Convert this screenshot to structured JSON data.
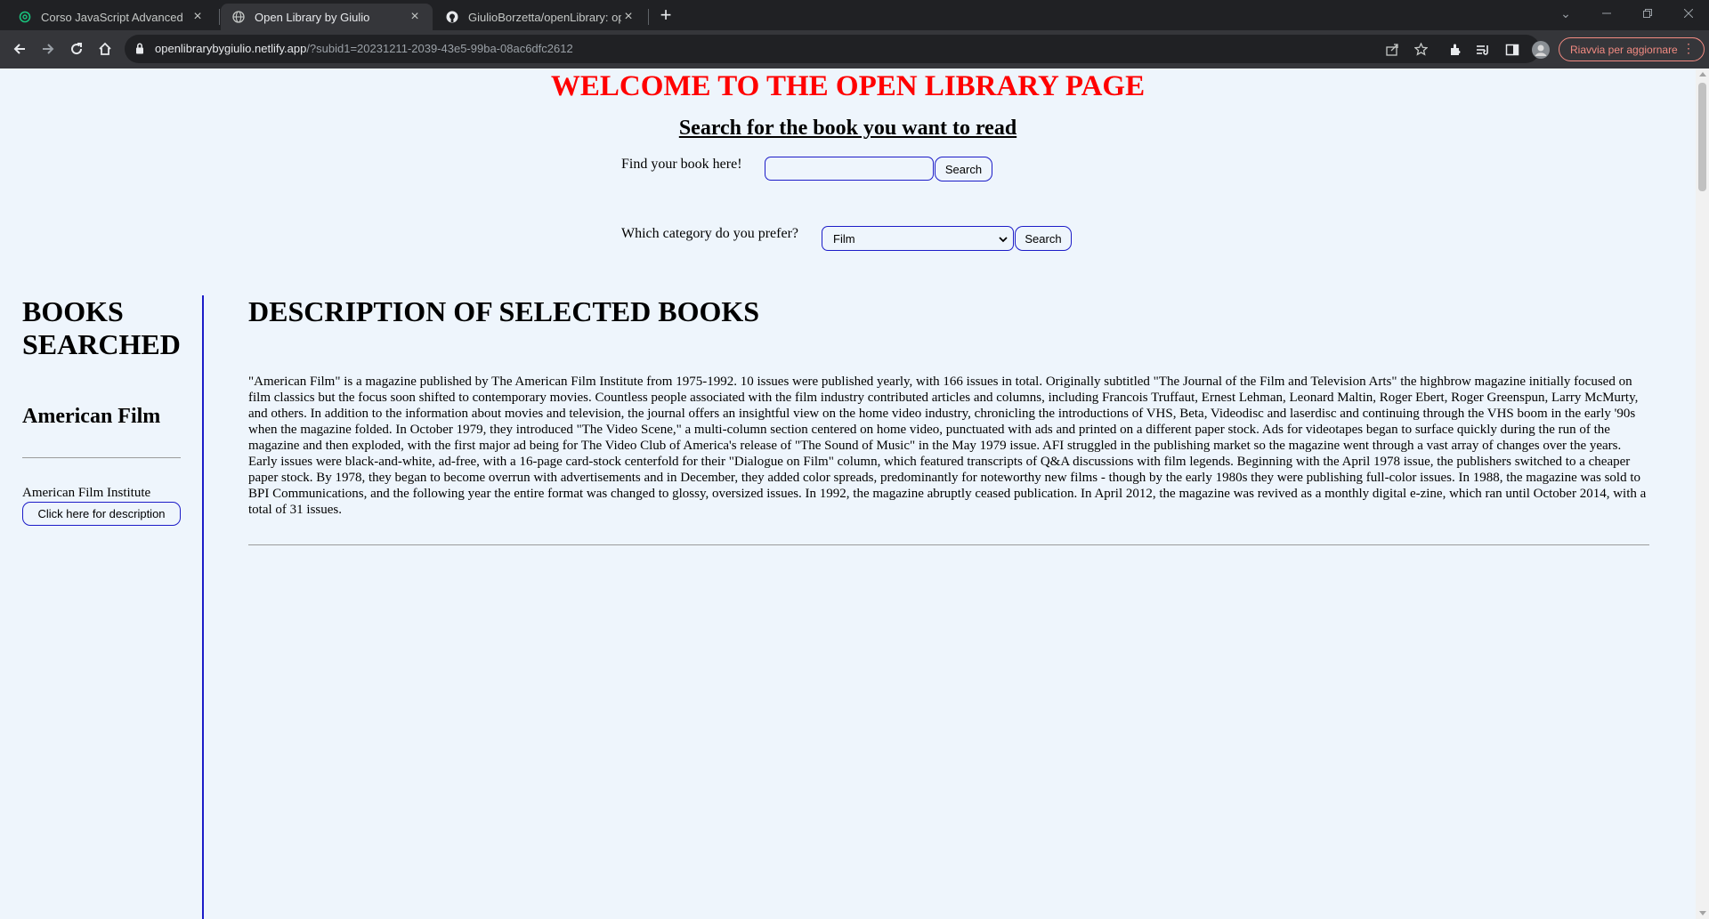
{
  "browser": {
    "tabs": [
      {
        "title": "Corso JavaScript Advanced",
        "icon": "openai-icon"
      },
      {
        "title": "Open Library by Giulio",
        "icon": "globe-icon"
      },
      {
        "title": "GiulioBorzetta/openLibrary: ope",
        "icon": "github-icon"
      }
    ],
    "url_host": "openlibrarybygiulio.netlify.app",
    "url_rest": "/?subid1=20231211-2039-43e5-99ba-08ac6dfc2612",
    "update_label": "Riavvia per aggiornare"
  },
  "header": {
    "title": "WELCOME TO THE OPEN LIBRARY PAGE",
    "subtitle": "Search for the book you want to read"
  },
  "search": {
    "label": "Find your book here!",
    "value": "",
    "button": "Search"
  },
  "category": {
    "label": "Which category do you prefer?",
    "selected": "Film",
    "button": "Search"
  },
  "sidebar": {
    "heading": "BOOKS SEARCHED",
    "book_title": "American Film",
    "author": "American Film Institute",
    "description_button": "Click here for description"
  },
  "main": {
    "heading": "DESCRIPTION OF SELECTED BOOKS",
    "description": "\"American Film\" is a magazine published by The American Film Institute from 1975-1992. 10 issues were published yearly, with 166 issues in total. Originally subtitled \"The Journal of the Film and Television Arts\" the highbrow magazine initially focused on film classics but the focus soon shifted to contemporary movies. Countless people associated with the film industry contributed articles and columns, including Francois Truffaut, Ernest Lehman, Leonard Maltin, Roger Ebert, Roger Greenspun, Larry McMurty, and others. In addition to the information about movies and television, the journal offers an insightful view on the home video industry, chronicling the introductions of VHS, Beta, Videodisc and laserdisc and continuing through the VHS boom in the early '90s when the magazine folded. In October 1979, they introduced \"The Video Scene,\" a multi-column section centered on home video, punctuated with ads and printed on a different paper stock. Ads for videotapes began to surface quickly during the run of the magazine and then exploded, with the first major ad being for The Video Club of America's release of \"The Sound of Music\" in the May 1979 issue. AFI struggled in the publishing market so the magazine went through a vast array of changes over the years. Early issues were black-and-white, ad-free, with a 16-page card-stock centerfold for their \"Dialogue on Film\" column, which featured transcripts of Q&A discussions with film legends. Beginning with the April 1978 issue, the publishers switched to a cheaper paper stock. By 1978, they began to become overrun with advertisements and in December, they added color spreads, predominantly for noteworthy new films - though by the early 1980s they were publishing full-color issues. In 1988, the magazine was sold to BPI Communications, and the following year the entire format was changed to glossy, oversized issues. In 1992, the magazine abruptly ceased publication. In April 2012, the magazine was revived as a monthly digital e-zine, which ran until October 2014, with a total of 31 issues."
  },
  "colors": {
    "title_red": "#ff0000",
    "accent_blue": "#1c1cc8",
    "page_bg": "#eef5fc"
  }
}
